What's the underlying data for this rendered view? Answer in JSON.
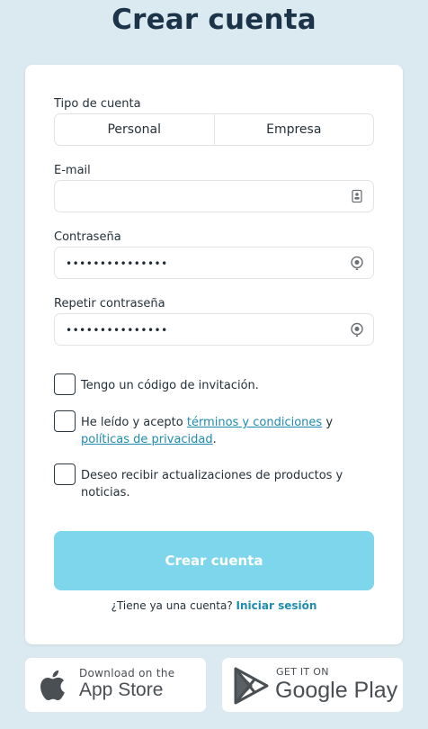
{
  "title": "Crear cuenta",
  "account_type": {
    "label": "Tipo de cuenta",
    "options": [
      "Personal",
      "Empresa"
    ]
  },
  "email": {
    "label": "E-mail",
    "value": "",
    "icon": "contact-card-icon"
  },
  "password": {
    "label": "Contraseña",
    "value": "•••••••••••••••",
    "icon": "eye-icon"
  },
  "repeat_password": {
    "label": "Repetir contraseña",
    "value": "•••••••••••••••",
    "icon": "eye-icon"
  },
  "checkboxes": {
    "invitation": "Tengo un código de invitación.",
    "terms_prefix": "He leído y acepto ",
    "terms_link": "términos y condiciones",
    "terms_and": " y ",
    "privacy_link": "políticas de privacidad",
    "terms_suffix": ".",
    "updates": "Deseo recibir actualizaciones de productos y noticias."
  },
  "submit_label": "Crear cuenta",
  "login": {
    "prompt": "¿Tiene ya una cuenta? ",
    "link": "Iniciar sesión"
  },
  "app_store": {
    "small": "Download on the",
    "big": "App Store"
  },
  "google_play": {
    "small": "GET IT ON",
    "big": "Google Play"
  },
  "colors": {
    "background": "#dbe9f0",
    "accent": "#1f8bb0",
    "button_disabled": "#7dd6eb"
  }
}
